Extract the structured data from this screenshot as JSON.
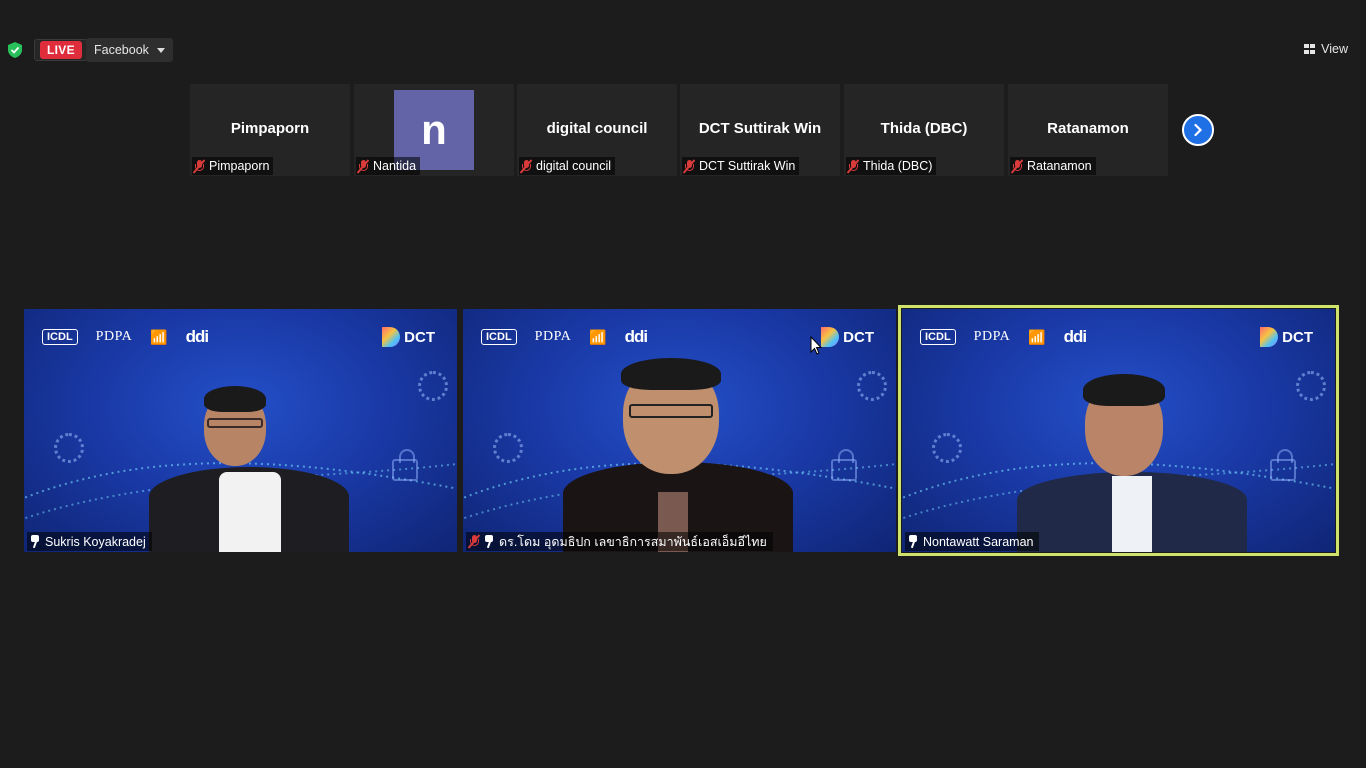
{
  "topbar": {
    "live_label": "LIVE",
    "stream_target": "Facebook",
    "view_label": "View"
  },
  "strip": [
    {
      "display": "Pimpaporn",
      "label": "Pimpaporn",
      "muted": true
    },
    {
      "display": "n",
      "label": "Nantida",
      "muted": true,
      "avatar": true
    },
    {
      "display": "digital council",
      "label": "digital council",
      "muted": true
    },
    {
      "display": "DCT Suttirak Win",
      "label": "DCT Suttirak Win",
      "muted": true
    },
    {
      "display": "Thida (DBC)",
      "label": "Thida (DBC)",
      "muted": true
    },
    {
      "display": "Ratanamon",
      "label": "Ratanamon",
      "muted": true
    }
  ],
  "videos": [
    {
      "name": "Sukris Koyakradej",
      "pinned": true,
      "muted": false,
      "active": false
    },
    {
      "name": "ดร.โดม อุดมธิปก เลขาธิการสมาพันธ์เอสเอ็มอีไทย",
      "pinned": true,
      "muted": true,
      "active": false
    },
    {
      "name": "Nontawatt Saraman",
      "pinned": true,
      "muted": false,
      "active": true
    }
  ],
  "backdrop": {
    "logo_icdl": "ICDL",
    "logo_pdpa": "PDPA",
    "logo_ddi": "ddi",
    "logo_dct": "DCT"
  },
  "colors": {
    "background": "#1c1c1c",
    "live": "#e02d3c",
    "active_speaker": "#cfe36a",
    "next_button": "#1f6fe5",
    "avatar": "#6264a7"
  }
}
